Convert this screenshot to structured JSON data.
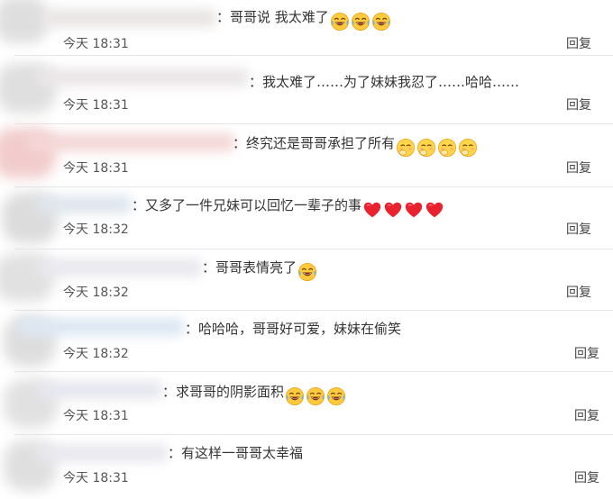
{
  "comments": [
    {
      "text": "：哥哥说 我太难了",
      "emoji": "laugh-cry-emoji",
      "emoji_count": 3,
      "time": "今天 18:31",
      "reply": "回复"
    },
    {
      "text": "：我太难了……为了妹妹我忍了……哈哈……",
      "emoji": "",
      "emoji_count": 0,
      "time": "今天 18:31",
      "reply": "回复"
    },
    {
      "text": "：终究还是哥哥承担了所有",
      "emoji": "chuckle-emoji",
      "emoji_count": 4,
      "time": "今天 18:31",
      "reply": "回复"
    },
    {
      "text": "：又多了一件兄妹可以回忆一辈子的事",
      "emoji": "red-heart-emoji",
      "emoji_count": 4,
      "time": "今天 18:32",
      "reply": "回复"
    },
    {
      "text": "：哥哥表情亮了",
      "emoji": "laugh-cry-emoji",
      "emoji_count": 1,
      "time": "今天 18:32",
      "reply": "回复"
    },
    {
      "text": "：哈哈哈，哥哥好可爱，妹妹在偷笑",
      "emoji": "",
      "emoji_count": 0,
      "time": "今天 18:32",
      "reply": "回复"
    },
    {
      "text": "：求哥哥的阴影面积",
      "emoji": "laugh-cry-emoji",
      "emoji_count": 3,
      "time": "今天 18:31",
      "reply": "回复"
    },
    {
      "text": "：有这样一哥哥太幸福",
      "emoji": "",
      "emoji_count": 0,
      "time": "今天 18:31",
      "reply": "回复"
    }
  ]
}
